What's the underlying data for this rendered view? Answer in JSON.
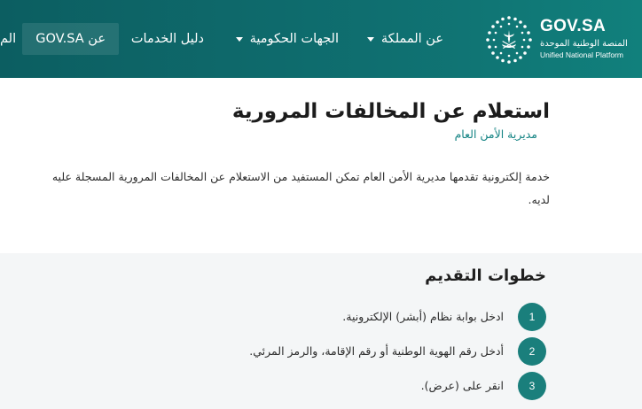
{
  "header": {
    "logo": {
      "title": "GOV.SA",
      "subtitle_ar": "المنصة الوطنية الموحدة",
      "subtitle_en": "Unified National Platform"
    },
    "nav": [
      {
        "label": "عن المملكة",
        "has_dropdown": true
      },
      {
        "label": "الجهات الحكومية",
        "has_dropdown": true
      },
      {
        "label": "دليل الخدمات",
        "has_dropdown": false
      },
      {
        "label": "عن GOV.SA",
        "has_dropdown": false
      },
      {
        "label": "الم",
        "has_dropdown": false
      }
    ]
  },
  "main": {
    "title": "استعلام عن المخالفات المرورية",
    "subtitle": "مديرية الأمن العام",
    "description_lines": [
      "خدمة إلكترونية تقدمها مديرية الأمن العام تمكن المستفيد من الاستعلام عن المخالفات المرورية المسجلة عليه",
      "لديه."
    ]
  },
  "steps": {
    "title": "خطوات التقديم",
    "items": [
      {
        "number": "1",
        "text": "ادخل بوابة نظام (أبشر) الإلكترونية."
      },
      {
        "number": "2",
        "text": "أدخل رقم الهوية الوطنية أو رقم الإقامة، والرمز المرئي."
      },
      {
        "number": "3",
        "text": "انقر على (عرض)."
      }
    ]
  },
  "colors": {
    "header_bg": "#0f6f70",
    "accent": "#138383",
    "step_circle": "#1a7f7c",
    "steps_bg": "#f4f6f7"
  }
}
